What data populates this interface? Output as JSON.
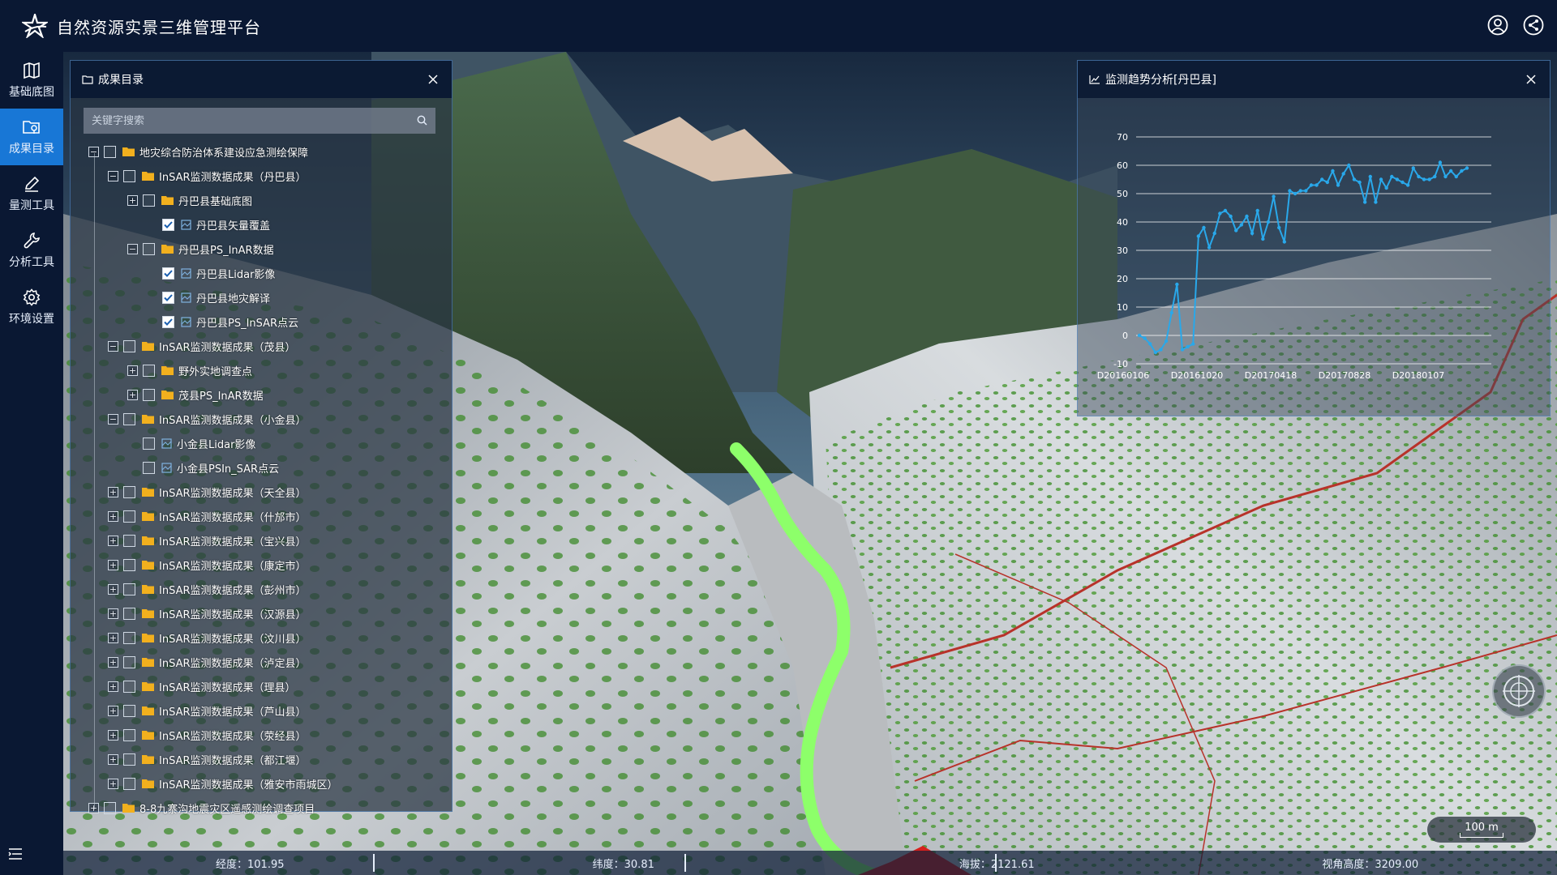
{
  "app": {
    "title": "自然资源实景三维管理平台"
  },
  "top_actions": [
    {
      "icon": "user-icon"
    },
    {
      "icon": "share-icon"
    }
  ],
  "sidebar": {
    "items": [
      {
        "label": "基础底图",
        "icon": "map-icon",
        "active": false
      },
      {
        "label": "成果目录",
        "icon": "folder-map-icon",
        "active": true
      },
      {
        "label": "量测工具",
        "icon": "pen-icon",
        "active": false
      },
      {
        "label": "分析工具",
        "icon": "wrench-icon",
        "active": false
      },
      {
        "label": "环境设置",
        "icon": "gear-icon",
        "active": false
      }
    ]
  },
  "catalog": {
    "title": "成果目录",
    "search_placeholder": "关键字搜索",
    "items": [
      {
        "label": "地灾综合防治体系建设应急测绘保障",
        "level": 0,
        "expander": "−",
        "checked": false,
        "type": "folder"
      },
      {
        "label": "InSAR监测数据成果（丹巴县）",
        "level": 1,
        "expander": "−",
        "checked": false,
        "type": "folder"
      },
      {
        "label": "丹巴县基础底图",
        "level": 2,
        "expander": "+",
        "checked": false,
        "type": "folder"
      },
      {
        "label": "丹巴县矢量覆盖",
        "level": 3,
        "expander": "",
        "checked": true,
        "type": "layer"
      },
      {
        "label": "丹巴县PS_InAR数据",
        "level": 2,
        "expander": "−",
        "checked": false,
        "type": "folder"
      },
      {
        "label": "丹巴县Lidar影像",
        "level": 3,
        "expander": "",
        "checked": true,
        "type": "layer"
      },
      {
        "label": "丹巴县地灾解译",
        "level": 3,
        "expander": "",
        "checked": true,
        "type": "layer"
      },
      {
        "label": "丹巴县PS_InSAR点云",
        "level": 3,
        "expander": "",
        "checked": true,
        "type": "layer"
      },
      {
        "label": "InSAR监测数据成果（茂县）",
        "level": 1,
        "expander": "−",
        "checked": false,
        "type": "folder"
      },
      {
        "label": "野外实地调查点",
        "level": 2,
        "expander": "+",
        "checked": false,
        "type": "folder"
      },
      {
        "label": "茂县PS_InAR数据",
        "level": 2,
        "expander": "+",
        "checked": false,
        "type": "folder"
      },
      {
        "label": "InSAR监测数据成果（小金县）",
        "level": 1,
        "expander": "−",
        "checked": false,
        "type": "folder"
      },
      {
        "label": "小金县Lidar影像",
        "level": 2,
        "expander": "",
        "checked": false,
        "type": "layer"
      },
      {
        "label": "小金县PSIn_SAR点云",
        "level": 2,
        "expander": "",
        "checked": false,
        "type": "layer"
      },
      {
        "label": "InSAR监测数据成果（天全县）",
        "level": 1,
        "expander": "+",
        "checked": false,
        "type": "folder"
      },
      {
        "label": "InSAR监测数据成果（什邡市）",
        "level": 1,
        "expander": "+",
        "checked": false,
        "type": "folder"
      },
      {
        "label": "InSAR监测数据成果（宝兴县）",
        "level": 1,
        "expander": "+",
        "checked": false,
        "type": "folder"
      },
      {
        "label": "InSAR监测数据成果（康定市）",
        "level": 1,
        "expander": "+",
        "checked": false,
        "type": "folder"
      },
      {
        "label": "InSAR监测数据成果（彭州市）",
        "level": 1,
        "expander": "+",
        "checked": false,
        "type": "folder"
      },
      {
        "label": "InSAR监测数据成果（汉源县）",
        "level": 1,
        "expander": "+",
        "checked": false,
        "type": "folder"
      },
      {
        "label": "InSAR监测数据成果（汶川县）",
        "level": 1,
        "expander": "+",
        "checked": false,
        "type": "folder"
      },
      {
        "label": "InSAR监测数据成果（泸定县）",
        "level": 1,
        "expander": "+",
        "checked": false,
        "type": "folder"
      },
      {
        "label": "InSAR监测数据成果（理县）",
        "level": 1,
        "expander": "+",
        "checked": false,
        "type": "folder"
      },
      {
        "label": "InSAR监测数据成果（芦山县）",
        "level": 1,
        "expander": "+",
        "checked": false,
        "type": "folder"
      },
      {
        "label": "InSAR监测数据成果（荥经县）",
        "level": 1,
        "expander": "+",
        "checked": false,
        "type": "folder"
      },
      {
        "label": "InSAR监测数据成果（都江堰）",
        "level": 1,
        "expander": "+",
        "checked": false,
        "type": "folder"
      },
      {
        "label": "InSAR监测数据成果（雅安市雨城区）",
        "level": 1,
        "expander": "+",
        "checked": false,
        "type": "folder"
      },
      {
        "label": "8-8九寨沟地震灾区遥感测绘调查项目",
        "level": 0,
        "expander": "+",
        "checked": false,
        "type": "folder"
      }
    ]
  },
  "trend_panel": {
    "title": "监测趋势分析[丹巴县]"
  },
  "chart_data": {
    "type": "line",
    "title": "",
    "xlabel": "",
    "ylabel": "",
    "ylim": [
      -10,
      70
    ],
    "yticks": [
      -10,
      0,
      10,
      20,
      30,
      40,
      50,
      60,
      70
    ],
    "x_tick_labels": [
      "D20160106",
      "D20161020",
      "D20170418",
      "D20170828",
      "D20180107"
    ],
    "grid": true,
    "line_color": "#29a8ea",
    "series": [
      {
        "name": "",
        "values": [
          0,
          -1,
          -3,
          -6,
          -5,
          -2,
          8,
          18,
          -5,
          -4,
          -3,
          35,
          38,
          31,
          36,
          43,
          44,
          42,
          37,
          39,
          42,
          36,
          44,
          34,
          40,
          49,
          38,
          33,
          51,
          50,
          51,
          51,
          53,
          53,
          55,
          54,
          58,
          53,
          57,
          60,
          55,
          54,
          47,
          56,
          47,
          55,
          52,
          56,
          55,
          54,
          53,
          59,
          56,
          55,
          55,
          56,
          61,
          56,
          58,
          56,
          58,
          59
        ]
      }
    ]
  },
  "status": {
    "longitude": "经度：101.95",
    "latitude": "纬度：30.81",
    "altitude": "海拔：2121.61",
    "view_height": "视角高度：3209.00"
  },
  "scale": {
    "label": "100 m"
  },
  "colors": {
    "header_bg": "#0a1833",
    "active_nav": "#1877d6",
    "panel_border": "#508cd2",
    "river_line": "#8dff6a",
    "boundary_line": "#b8322a"
  }
}
